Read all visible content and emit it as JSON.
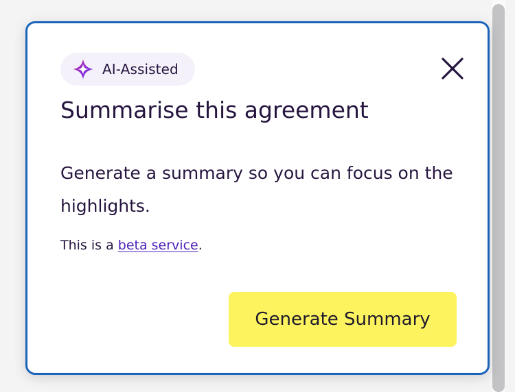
{
  "badge": {
    "label": "AI-Assisted",
    "icon": "sparkle-icon",
    "colors": {
      "primary": "#a91ea3",
      "secondary": "#5a2fd1"
    }
  },
  "dialog": {
    "title": "Summarise this agreement",
    "description": "Generate a summary so you can focus on the highlights.",
    "beta_prefix": "This is a ",
    "beta_link": "beta service",
    "beta_suffix": ".",
    "close_icon": "close-icon",
    "primary_button": "Generate Summary"
  },
  "colors": {
    "border": "#1a64b9",
    "text": "#26153f",
    "link": "#4b1fb8",
    "button": "#fcf35e",
    "badge_bg": "#f4f1fb"
  }
}
